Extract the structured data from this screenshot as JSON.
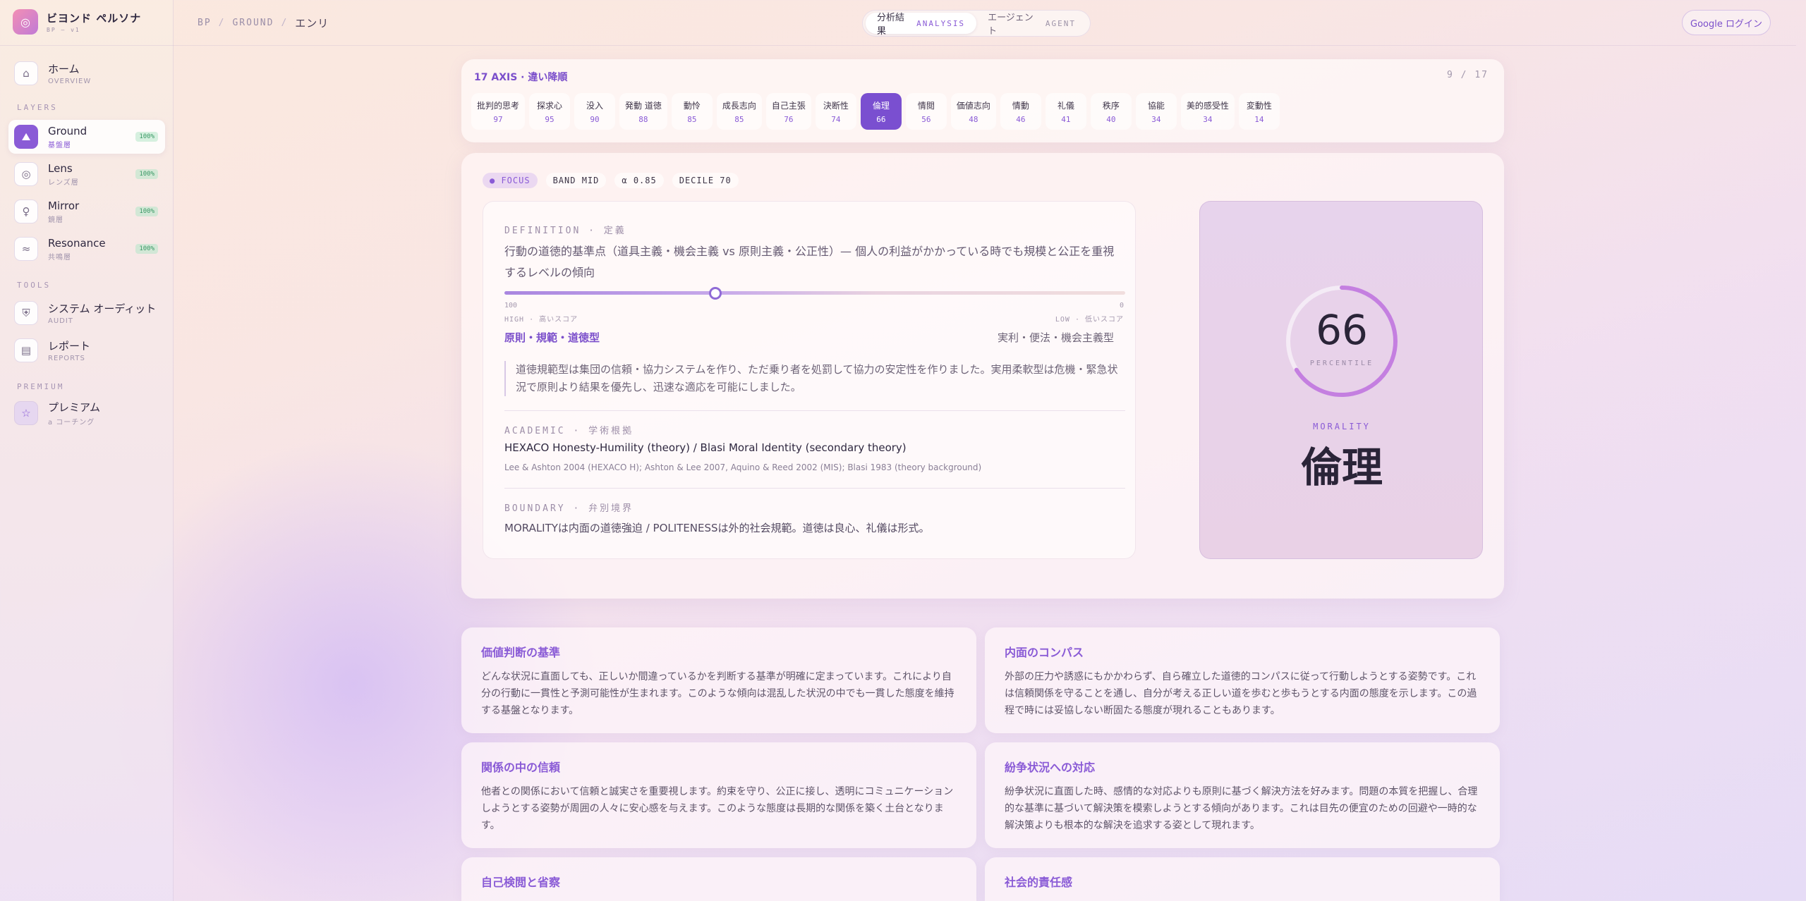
{
  "brand": {
    "name": "ビヨンド ペルソナ",
    "sub": "BP — v1",
    "logo_icon": "target-icon"
  },
  "sidebar": {
    "home": {
      "title": "ホーム",
      "sub": "OVERVIEW",
      "icon": "home-icon"
    },
    "layers_label": "LAYERS",
    "layers": [
      {
        "title": "Ground",
        "sub": "基盤層",
        "badge": "100%",
        "icon": "ground-icon"
      },
      {
        "title": "Lens",
        "sub": "レンズ層",
        "badge": "100%",
        "icon": "lens-icon"
      },
      {
        "title": "Mirror",
        "sub": "鏡層",
        "badge": "100%",
        "icon": "mirror-icon"
      },
      {
        "title": "Resonance",
        "sub": "共鳴層",
        "badge": "100%",
        "icon": "resonance-icon"
      }
    ],
    "tools_label": "TOOLS",
    "tools": [
      {
        "title": "システム オーディット",
        "sub": "AUDIT",
        "icon": "shield-icon"
      },
      {
        "title": "レポート",
        "sub": "REPORTS",
        "icon": "document-icon"
      }
    ],
    "premium_label": "PREMIUM",
    "premium": {
      "title": "プレミアム",
      "sub": "a コーチング",
      "icon": "star-icon"
    }
  },
  "breadcrumb": {
    "root": "BP",
    "layer": "GROUND",
    "current": "エンリ"
  },
  "mode_switch": {
    "analysis": {
      "jp": "分析結果",
      "en": "ANALYSIS"
    },
    "agent": {
      "jp": "エージェント",
      "en": "AGENT"
    }
  },
  "google_login": "Google ログイン",
  "axis_bar": {
    "title": "17 AXIS · 違い降順",
    "count": "9 / 17",
    "axes": [
      {
        "name": "批判的思考",
        "value": "97"
      },
      {
        "name": "探求心",
        "value": "95"
      },
      {
        "name": "没入",
        "value": "90"
      },
      {
        "name": "発動 道徳",
        "value": "88"
      },
      {
        "name": "動怜",
        "value": "85"
      },
      {
        "name": "成長志向",
        "value": "85"
      },
      {
        "name": "自己主張",
        "value": "76"
      },
      {
        "name": "決断性",
        "value": "74"
      },
      {
        "name": "倫理",
        "value": "66",
        "active": true
      },
      {
        "name": "情閲",
        "value": "56"
      },
      {
        "name": "価値志向",
        "value": "48"
      },
      {
        "name": "情動",
        "value": "46"
      },
      {
        "name": "礼儀",
        "value": "41"
      },
      {
        "name": "秩序",
        "value": "40"
      },
      {
        "name": "協能",
        "value": "34"
      },
      {
        "name": "美的感受性",
        "value": "34"
      },
      {
        "name": "変動性",
        "value": "14"
      }
    ]
  },
  "focus": {
    "tags": [
      "● FOCUS",
      "BAND MID",
      "α 0.85",
      "DECILE 70"
    ],
    "definition_label": "DEFINITION · 定義",
    "definition": "行動の道徳的基準点（道具主義・機会主義 vs 原則主義・公正性）— 個人の利益がかかっている時でも規模と公正を重視するレベルの傾向",
    "slider_value": 66,
    "scale_high": "100",
    "scale_low": "0",
    "high_label": "HIGH · 高いスコア",
    "low_label": "LOW · 低いスコア",
    "high_pole": "原則・規範・道徳型",
    "low_pole": "実利・便法・機会主義型",
    "quote": "道徳規範型は集団の信頼・協力システムを作り、ただ乗り者を処罰して協力の安定性を作りました。実用柔軟型は危機・緊急状況で原則より結果を優先し、迅速な適応を可能にしました。",
    "academic_label": "ACADEMIC · 学術根拠",
    "academic_main": "HEXACO Honesty-Humility (theory) / Blasi Moral Identity (secondary theory)",
    "academic_refs": "Lee & Ashton 2004 (HEXACO H); Ashton & Lee 2007, Aquino & Reed 2002 (MIS); Blasi 1983 (theory background)",
    "boundary_label": "BOUNDARY · 弁別境界",
    "boundary": "MORALITYは内面の道徳強迫 / POLITENESSは外的社会規範。道徳は良心、礼儀は形式。"
  },
  "score": {
    "value": "66",
    "percent": 66,
    "unit": "PERCENTILE",
    "en": "MORALITY",
    "jp": "倫理",
    "accent": "#c47fe0"
  },
  "traits": [
    {
      "title": "価値判断の基準",
      "body": "どんな状況に直面しても、正しいか間違っているかを判断する基準が明確に定まっています。これにより自分の行動に一貫性と予測可能性が生まれます。このような傾向は混乱した状況の中でも一貫した態度を維持する基盤となります。"
    },
    {
      "title": "内面のコンパス",
      "body": "外部の圧力や誘惑にもかかわらず、自ら確立した道徳的コンパスに従って行動しようとする姿勢です。これは信頼関係を守ることを通し、自分が考える正しい道を歩むと歩もうとする内面の態度を示します。この過程で時には妥協しない断固たる態度が現れることもあります。"
    },
    {
      "title": "関係の中の信頼",
      "body": "他者との関係において信頼と誠実さを重要視します。約束を守り、公正に接し、透明にコミュニケーションしようとする姿勢が周囲の人々に安心感を与えます。このような態度は長期的な関係を築く土台となります。"
    },
    {
      "title": "紛争状況への対応",
      "body": "紛争状況に直面した時、感情的な対応よりも原則に基づく解決方法を好みます。問題の本質を把握し、合理的な基準に基づいて解決策を模索しようとする傾向があります。これは目先の便宜のための回避や一時的な解決策よりも根本的な解決を追求する姿として現れます。"
    },
    {
      "title": "自己検閲と省察",
      "body": ""
    },
    {
      "title": "社会的責任感",
      "body": ""
    }
  ]
}
